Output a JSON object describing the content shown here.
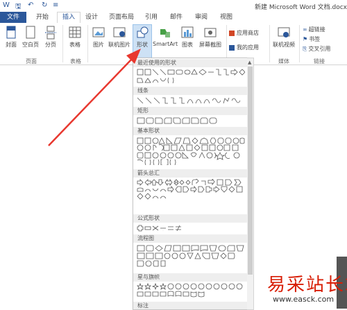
{
  "window": {
    "title": "新建 Microsoft Word 文档.docx"
  },
  "tabs": [
    {
      "label": "文件"
    },
    {
      "label": "开始"
    },
    {
      "label": "插入"
    },
    {
      "label": "设计"
    },
    {
      "label": "页面布局"
    },
    {
      "label": "引用"
    },
    {
      "label": "邮件"
    },
    {
      "label": "审阅"
    },
    {
      "label": "视图"
    }
  ],
  "ribbon": {
    "pages_group": {
      "label": "页面",
      "cover": "封面",
      "blank": "空白页",
      "break": "分页"
    },
    "tables_group": {
      "label": "表格",
      "table": "表格"
    },
    "illustrations": {
      "picture": "图片",
      "online_picture": "联机图片",
      "shapes": "形状",
      "smartart": "SmartArt",
      "chart": "图表",
      "screenshot": "屏幕截图"
    },
    "apps": {
      "store": "应用商店",
      "my_apps": "我的应用"
    },
    "media": {
      "online_video": "联机视频",
      "label": "媒体"
    },
    "links": {
      "hyperlink": "超链接",
      "bookmark": "书签",
      "crossref": "交叉引用",
      "label": "链接"
    }
  },
  "gallery": {
    "sections": [
      {
        "title": "最近使用的形状"
      },
      {
        "title": "线条"
      },
      {
        "title": "矩形"
      },
      {
        "title": "基本形状"
      },
      {
        "title": "箭头总汇"
      },
      {
        "title": "公式形状"
      },
      {
        "title": "流程图"
      },
      {
        "title": "星与旗帜"
      },
      {
        "title": "标注"
      }
    ]
  },
  "watermark": {
    "text": "易采站长站",
    "url": "www.easck.com"
  },
  "colors": {
    "accent": "#2b579a",
    "arrow": "#e8382f",
    "watermark": "#d81e06"
  }
}
